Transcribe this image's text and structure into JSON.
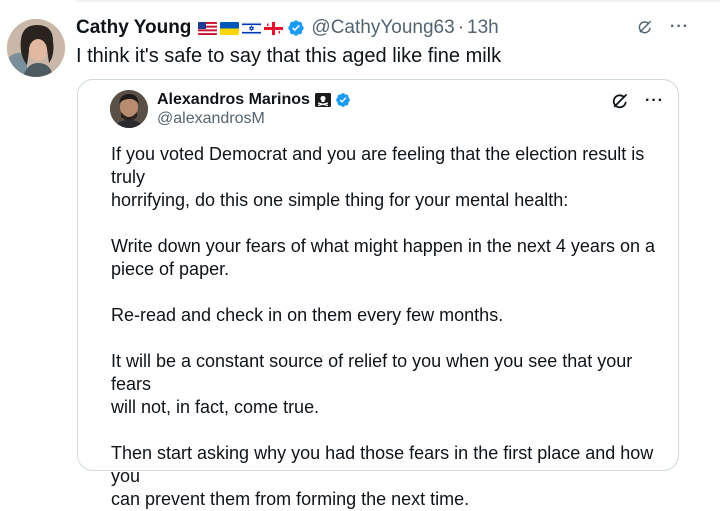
{
  "author": {
    "name": "Cathy Young",
    "handle": "@CathyYoung63",
    "separator": "·",
    "time": "13h",
    "flags": [
      "us-flag",
      "ukraine-flag",
      "israel-flag",
      "georgia-flag"
    ]
  },
  "tweet": {
    "text": "I think it's safe to say that this aged like fine milk"
  },
  "quoted": {
    "name": "Alexandros Marinos",
    "handle": "@alexandrosM",
    "paragraphs": [
      "If you voted Democrat and you are feeling that the election result is truly\nhorrifying, do this one simple thing for your mental health:",
      "Write down your fears of what might happen in the next 4 years on a\npiece of paper.",
      "Re-read and check in on them every few months.",
      "It will be a constant source of relief to you when you see that your fears\nwill not, in fact, come true.",
      "Then start asking why you had those fears in the first place and how you\ncan prevent them from forming the next time."
    ]
  },
  "icons": {
    "verified": "verified-badge-icon",
    "grok": "grok-icon",
    "more": "more-options-icon",
    "pirate": "pirate-flag-icon"
  },
  "colors": {
    "verified": "#1d9bf0",
    "text": "#0f1419",
    "secondary": "#536471",
    "border": "#cfd9de"
  }
}
